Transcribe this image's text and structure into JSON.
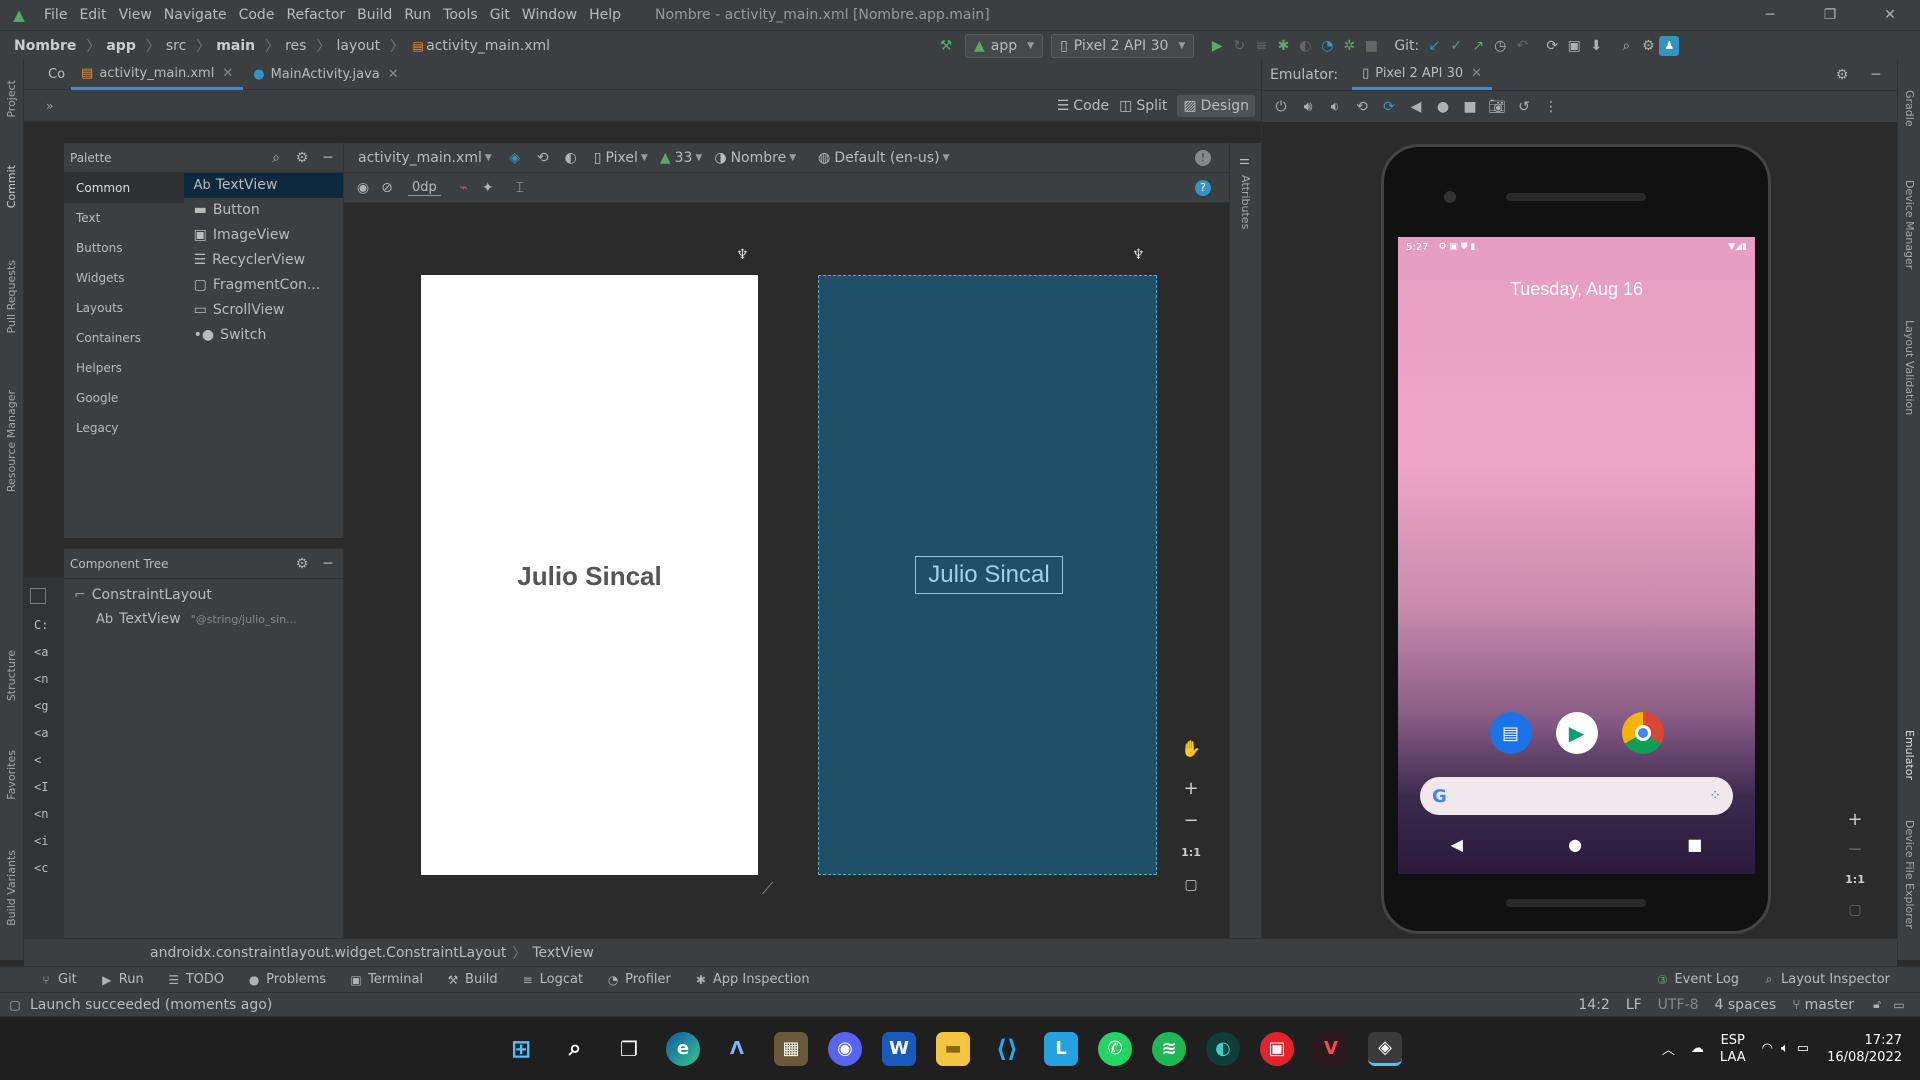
{
  "menu": {
    "items": [
      "File",
      "Edit",
      "View",
      "Navigate",
      "Code",
      "Refactor",
      "Build",
      "Run",
      "Tools",
      "Git",
      "Window",
      "Help"
    ],
    "title": "Nombre - activity_main.xml [Nombre.app.main]"
  },
  "breadcrumb": [
    "Nombre",
    "app",
    "src",
    "main",
    "res",
    "layout",
    "activity_main.xml"
  ],
  "toolbar": {
    "run_config": "app",
    "device": "Pixel 2 API 30",
    "git_label": "Git:"
  },
  "tabs": {
    "partial": "Co",
    "file1": "activity_main.xml",
    "file2": "MainActivity.java"
  },
  "editor_modes": {
    "code": "Code",
    "split": "Split",
    "design": "Design"
  },
  "palette": {
    "title": "Palette",
    "categories": [
      "Common",
      "Text",
      "Buttons",
      "Widgets",
      "Layouts",
      "Containers",
      "Helpers",
      "Google",
      "Legacy"
    ],
    "items": [
      "TextView",
      "Button",
      "ImageView",
      "RecyclerView",
      "FragmentCon...",
      "ScrollView",
      "Switch"
    ],
    "textview_prefix": "Ab"
  },
  "design_toolbar": {
    "file": "activity_main.xml",
    "device": "Pixel",
    "api": "33",
    "theme": "Nombre",
    "locale": "Default (en-us)",
    "margin": "0dp"
  },
  "component_tree": {
    "title": "Component Tree",
    "root": "ConstraintLayout",
    "child_prefix": "Ab",
    "child": "TextView",
    "child_value": "\"@string/julio_sin..."
  },
  "design_canvas": {
    "text": "Julio Sincal",
    "blueprint_text": "Julio Sincal",
    "zoom_reset": "1:1"
  },
  "side_panels": {
    "attributes": "Attributes",
    "left": [
      "Project",
      "Commit",
      "Pull Requests",
      "Resource Manager",
      "Structure",
      "Favorites",
      "Build Variants"
    ],
    "right": [
      "Gradle",
      "Device Manager",
      "Layout Validation",
      "Emulator",
      "Device File Explorer"
    ]
  },
  "emulator": {
    "label": "Emulator:",
    "tab": "Pixel 2 API 30",
    "status_time": "5:27",
    "date": "Tuesday, Aug 16",
    "zoom_reset": "1:1"
  },
  "status_path": {
    "class": "androidx.constraintlayout.widget.ConstraintLayout",
    "leaf": "TextView"
  },
  "bottom_tabs": [
    "Git",
    "Run",
    "TODO",
    "Problems",
    "Terminal",
    "Build",
    "Logcat",
    "Profiler",
    "App Inspection"
  ],
  "bottom_right": {
    "event_log": "Event Log",
    "layout_inspector": "Layout Inspector"
  },
  "status_bar": {
    "message": "Launch succeeded (moments ago)",
    "position": "14:2",
    "line_sep": "LF",
    "encoding": "UTF-8",
    "indent": "4 spaces",
    "branch": "master"
  },
  "taskbar": {
    "lang1": "ESP",
    "lang2": "LAA",
    "time": "17:27",
    "date": "16/08/2022"
  },
  "colors": {
    "ide_bg": "#2b2b2b",
    "panel_bg": "#3c3f41",
    "accent": "#4a88c7",
    "blueprint": "#1e5067",
    "run_green": "#59a869",
    "taskbar_bg": "#1f1f1f"
  }
}
